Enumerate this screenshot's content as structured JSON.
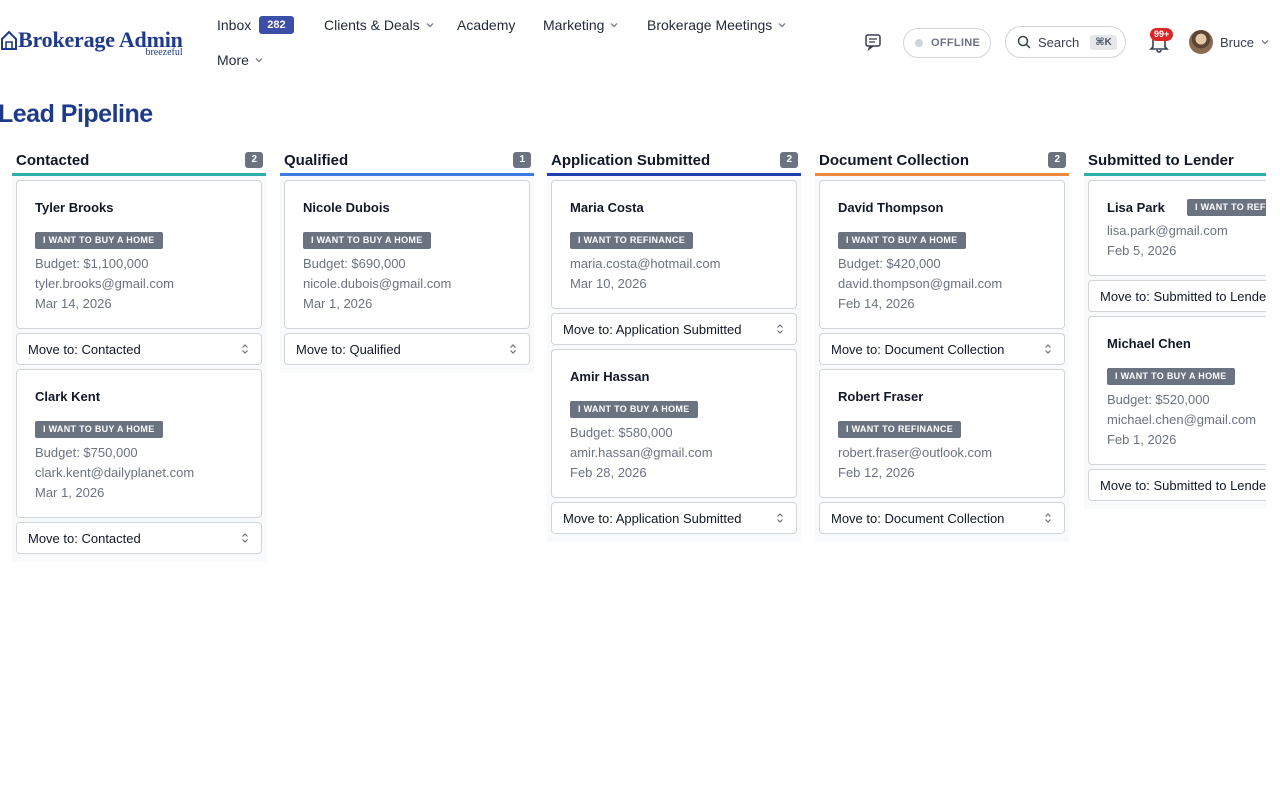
{
  "header": {
    "logo_text": "Brokerage Admin",
    "logo_sub": "breezeful",
    "nav": {
      "inbox_label": "Inbox",
      "inbox_count": "282",
      "clients_label": "Clients & Deals",
      "academy_label": "Academy",
      "marketing_label": "Marketing",
      "meetings_label": "Brokerage Meetings",
      "more_label": "More"
    },
    "status_label": "OFFLINE",
    "search_label": "Search",
    "search_shortcut": "⌘K",
    "notifications_count": "99+",
    "user_name": "Bruce"
  },
  "page": {
    "title": "Lead Pipeline"
  },
  "select_prefix": "Move to: ",
  "columns": [
    {
      "title": "Contacted",
      "count": "2",
      "color": "#2ab0a6",
      "select": "Move to: Contacted",
      "cards": [
        {
          "name": "Tyler Brooks",
          "tag": "I WANT TO BUY A HOME",
          "budget": "Budget: $1,100,000",
          "email": "tyler.brooks@gmail.com",
          "date": "Mar 14, 2026"
        },
        {
          "name": "Clark Kent",
          "tag": "I WANT TO BUY A HOME",
          "budget": "Budget: $750,000",
          "email": "clark.kent@dailyplanet.com",
          "date": "Mar 1, 2026"
        }
      ]
    },
    {
      "title": "Qualified",
      "count": "1",
      "color": "#3b7be0",
      "select": "Move to: Qualified",
      "cards": [
        {
          "name": "Nicole Dubois",
          "tag": "I WANT TO BUY A HOME",
          "budget": "Budget: $690,000",
          "email": "nicole.dubois@gmail.com",
          "date": "Mar 1, 2026"
        }
      ]
    },
    {
      "title": "Application Submitted",
      "count": "2",
      "color": "#1e40af",
      "select": "Move to: Application Submitted",
      "cards": [
        {
          "name": "Maria Costa",
          "tag": "I WANT TO REFINANCE",
          "email": "maria.costa@hotmail.com",
          "date": "Mar 10, 2026"
        },
        {
          "name": "Amir Hassan",
          "tag": "I WANT TO BUY A HOME",
          "budget": "Budget: $580,000",
          "email": "amir.hassan@gmail.com",
          "date": "Feb 28, 2026"
        }
      ]
    },
    {
      "title": "Document Collection",
      "count": "2",
      "color": "#f08a3c",
      "select": "Move to: Document Collection",
      "cards": [
        {
          "name": "David Thompson",
          "tag": "I WANT TO BUY A HOME",
          "budget": "Budget: $420,000",
          "email": "david.thompson@gmail.com",
          "date": "Feb 14, 2026"
        },
        {
          "name": "Robert Fraser",
          "tag": "I WANT TO REFINANCE",
          "email": "robert.fraser@outlook.com",
          "date": "Feb 12, 2026"
        }
      ]
    },
    {
      "title": "Submitted to Lender",
      "count": "",
      "color": "#2ab0a6",
      "select": "Move to: Submitted to Lende",
      "cards": [
        {
          "name": "Lisa Park",
          "tag": "I WANT TO REFI",
          "email": "lisa.park@gmail.com",
          "date": "Feb 5, 2026"
        },
        {
          "name": "Michael Chen",
          "tag": "I WANT TO BUY A HOME",
          "budget": "Budget: $520,000",
          "email": "michael.chen@gmail.com",
          "date": "Feb 1, 2026"
        }
      ]
    }
  ],
  "colors": {
    "brand": "#1e3a8a",
    "inbox_badge": "#3b4fa8",
    "tag": "#6b7280",
    "notification": "#dc2626"
  }
}
